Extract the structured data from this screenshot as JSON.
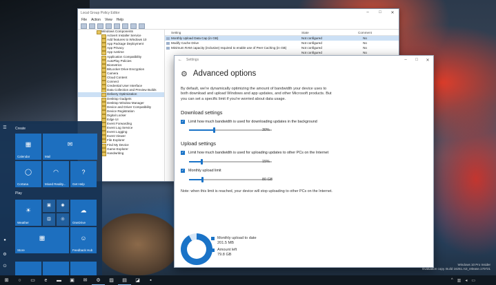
{
  "gpedit": {
    "title": "Local Group Policy Editor",
    "window_controls": [
      "–",
      "□",
      "✕"
    ],
    "menu": [
      "File",
      "Action",
      "View",
      "Help"
    ],
    "tree": [
      "Windows Components",
      "ActiveX Installer Service",
      "Add features to Windows 10",
      "App Package Deployment",
      "App Privacy",
      "App runtime",
      "Application Compatibility",
      "AutoPlay Policies",
      "Biometrics",
      "BitLocker Drive Encryption",
      "Camera",
      "Cloud Content",
      "Connect",
      "Credential User Interface",
      "Data Collection and Preview Builds",
      "Delivery Optimization",
      "Desktop Gadgets",
      "Desktop Window Manager",
      "Device and Driver Compatibility",
      "Device Registration",
      "Digital Locker",
      "Edge UI",
      "Event Forwarding",
      "Event Log Service",
      "Event Logging",
      "Event Viewer",
      "File Explorer",
      "Find My Device",
      "Game Explorer",
      "Handwriting"
    ],
    "selected_tree_index": 15,
    "columns": [
      "Setting",
      "State",
      "Comment"
    ],
    "rows": [
      {
        "setting": "Monthly Upload Data Cap (in GB)",
        "state": "Not configured",
        "comment": "No"
      },
      {
        "setting": "Modify Cache Drive",
        "state": "Not configured",
        "comment": "No"
      },
      {
        "setting": "Minimum RAM capacity (inclusive) required to enable use of Peer Caching (in GB)",
        "state": "Not configured",
        "comment": "No"
      },
      {
        "setting": "",
        "state": "Not configured",
        "comment": "No"
      },
      {
        "setting": "",
        "state": "Not configured",
        "comment": "No"
      },
      {
        "setting": "",
        "state": "Not configured",
        "comment": "No"
      },
      {
        "setting": "",
        "state": "Not configured",
        "comment": "No"
      }
    ],
    "peek_rows": [
      "D",
      "D",
      "D",
      "Al",
      "Bi",
      "G",
      "D",
      "M",
      "M",
      "M",
      "Al"
    ]
  },
  "settings": {
    "app_title": "Settings",
    "back_glyph": "←",
    "window_controls": [
      "–",
      "□",
      "✕"
    ],
    "page_title": "Advanced options",
    "description": "By default, we're dynamically optimizing the amount of bandwidth your device uses to both download and upload Windows and app updates, and other Microsoft products. But you can set a specific limit if you're worried about data usage.",
    "download_heading": "Download settings",
    "download_limit_label": "Limit how much bandwidth is used for downloading updates in the background",
    "download_limit_checked": true,
    "download_value": "30%",
    "download_fraction": 0.3,
    "upload_heading": "Upload settings",
    "upload_limit_label": "Limit how much bandwidth is used for uploading updates to other PCs on the Internet",
    "upload_limit_checked": true,
    "upload_value": "15%",
    "upload_fraction": 0.15,
    "monthly_limit_label": "Monthly upload limit",
    "monthly_limit_checked": true,
    "monthly_value": "80 GB",
    "monthly_fraction": 0.16,
    "note": "Note: when this limit is reached, your device will stop uploading to other PCs on the Internet.",
    "legend_upload_label": "Monthly upload to date",
    "legend_upload_value": "201.5 MB",
    "legend_left_label": "Amount left",
    "legend_left_value": "79.8 GB",
    "donut_used_percent": 92,
    "check_glyph": "✓"
  },
  "start_menu": {
    "create_label": "Create",
    "play_label": "Play",
    "tiles": {
      "calendar": "Calendar",
      "mail": "Mail",
      "cortana": "Cortana",
      "mixed_reality": "Mixed Reality...",
      "get_help": "Get Help",
      "weather": "Weather",
      "onedrive": "OneDrive",
      "store": "Store",
      "feedback_hub": "Feedback Hub"
    }
  },
  "watermark": {
    "line1": "Windows 10 Pro Insider",
    "line2": "Evaluation copy. Build 16251.rs3_release.170721"
  },
  "colors": {
    "accent": "#1a73c7",
    "tile": "#1d6fbf",
    "taskbar": "#101820"
  }
}
